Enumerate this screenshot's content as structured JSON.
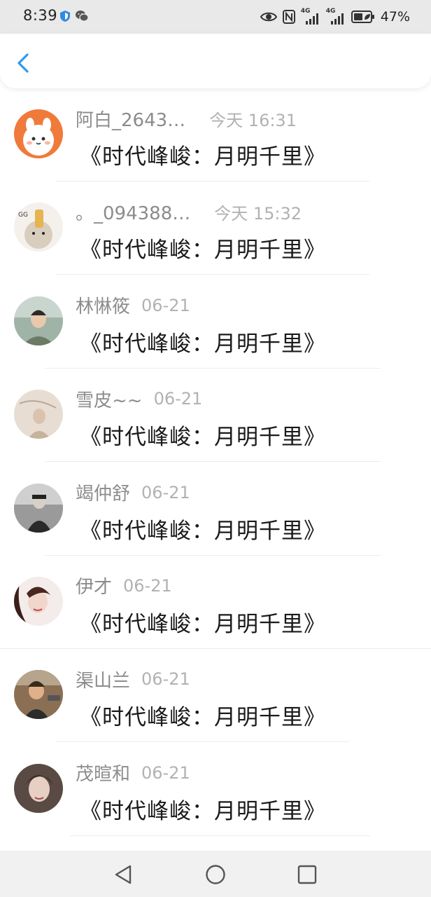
{
  "status_bar": {
    "time": "8:39",
    "battery_percent": "47%",
    "network_label_1": "4G",
    "network_label_2": "4G",
    "icons": [
      "shield-icon",
      "wechat-icon",
      "eye-icon",
      "nfc-icon",
      "signal-icon",
      "signal-icon",
      "battery-icon"
    ]
  },
  "header": {
    "back_icon": "chevron-left-icon",
    "accent_color": "#2e9bf0"
  },
  "messages": [
    {
      "name": "阿白_2643…",
      "time": "今天 16:31",
      "text": "《时代峰峻：月明千里》"
    },
    {
      "name": "。_094388…",
      "time": "今天 15:32",
      "text": "《时代峰峻：月明千里》"
    },
    {
      "name": "林惏筱",
      "time": "06-21",
      "text": "《时代峰峻：月明千里》"
    },
    {
      "name": "雪皮~~",
      "time": "06-21",
      "text": "《时代峰峻：月明千里》"
    },
    {
      "name": "竭仲舒",
      "time": "06-21",
      "text": "《时代峰峻：月明千里》"
    },
    {
      "name": "伊才",
      "time": "06-21",
      "text": "《时代峰峻：月明千里》"
    },
    {
      "name": "渠山兰",
      "time": "06-21",
      "text": "《时代峰峻：月明千里》"
    },
    {
      "name": "茂暄和",
      "time": "06-21",
      "text": "《时代峰峻：月明千里》"
    }
  ],
  "nav_bar": {
    "icons": [
      "back-triangle-icon",
      "home-circle-icon",
      "recents-square-icon"
    ]
  }
}
